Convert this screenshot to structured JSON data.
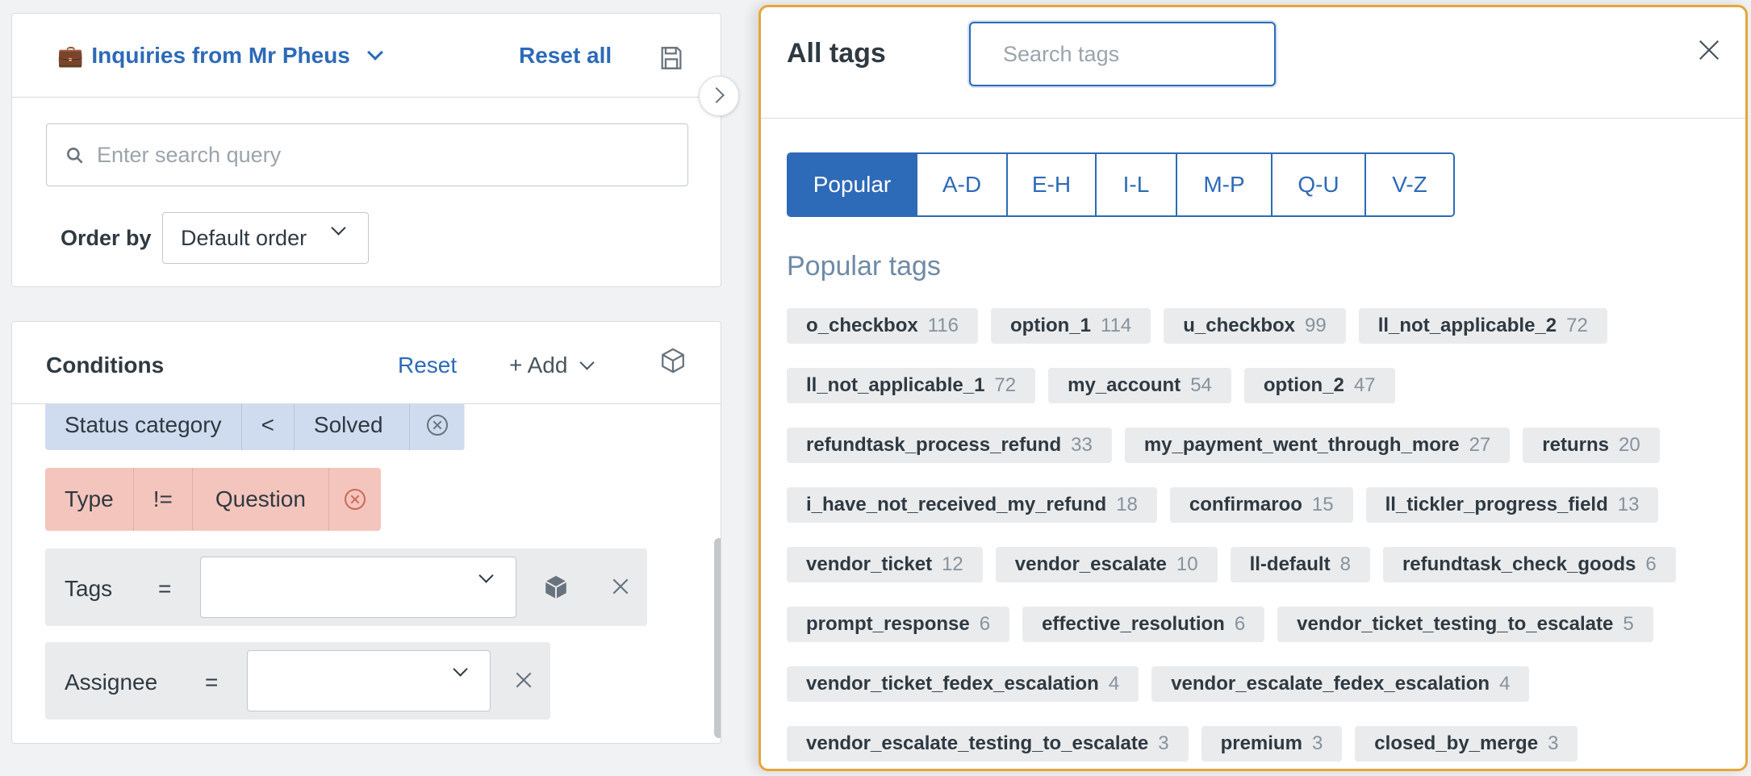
{
  "view": {
    "icon": "briefcase-icon",
    "title": "Inquiries from Mr Pheus",
    "reset_all": "Reset all",
    "save_icon": "save-icon",
    "search_placeholder": "Enter search query",
    "order_by_label": "Order by",
    "order_by_value": "Default order"
  },
  "conditions": {
    "title": "Conditions",
    "reset": "Reset",
    "add": "+ Add",
    "chips": [
      {
        "field": "Status category",
        "op": "<",
        "value": "Solved",
        "color": "#cfdcf0"
      },
      {
        "field": "Type",
        "op": "!=",
        "value": "Question",
        "color": "#f4c5bc"
      }
    ],
    "rows": [
      {
        "field": "Tags",
        "op": "="
      },
      {
        "field": "Assignee",
        "op": "="
      }
    ]
  },
  "tags_panel": {
    "title": "All tags",
    "search_placeholder": "Search tags",
    "tabs": [
      "Popular",
      "A-D",
      "E-H",
      "I-L",
      "M-P",
      "Q-U",
      "V-Z"
    ],
    "active_tab": "Popular",
    "heading": "Popular tags",
    "accent": "#e8a53a",
    "rows": [
      [
        {
          "name": "o_checkbox",
          "count": "116"
        },
        {
          "name": "option_1",
          "count": "114"
        },
        {
          "name": "u_checkbox",
          "count": "99"
        },
        {
          "name": "ll_not_applicable_2",
          "count": "72"
        }
      ],
      [
        {
          "name": "ll_not_applicable_1",
          "count": "72"
        },
        {
          "name": "my_account",
          "count": "54"
        },
        {
          "name": "option_2",
          "count": "47"
        }
      ],
      [
        {
          "name": "refundtask_process_refund",
          "count": "33"
        },
        {
          "name": "my_payment_went_through_more",
          "count": "27"
        },
        {
          "name": "returns",
          "count": "20"
        }
      ],
      [
        {
          "name": "i_have_not_received_my_refund",
          "count": "18"
        },
        {
          "name": "confirmaroo",
          "count": "15"
        },
        {
          "name": "ll_tickler_progress_field",
          "count": "13"
        }
      ],
      [
        {
          "name": "vendor_ticket",
          "count": "12"
        },
        {
          "name": "vendor_escalate",
          "count": "10"
        },
        {
          "name": "ll-default",
          "count": "8"
        },
        {
          "name": "refundtask_check_goods",
          "count": "6"
        }
      ],
      [
        {
          "name": "prompt_response",
          "count": "6"
        },
        {
          "name": "effective_resolution",
          "count": "6"
        },
        {
          "name": "vendor_ticket_testing_to_escalate",
          "count": "5"
        }
      ],
      [
        {
          "name": "vendor_ticket_fedex_escalation",
          "count": "4"
        },
        {
          "name": "vendor_escalate_fedex_escalation",
          "count": "4"
        }
      ],
      [
        {
          "name": "vendor_escalate_testing_to_escalate",
          "count": "3"
        },
        {
          "name": "premium",
          "count": "3"
        },
        {
          "name": "closed_by_merge",
          "count": "3"
        }
      ]
    ]
  }
}
